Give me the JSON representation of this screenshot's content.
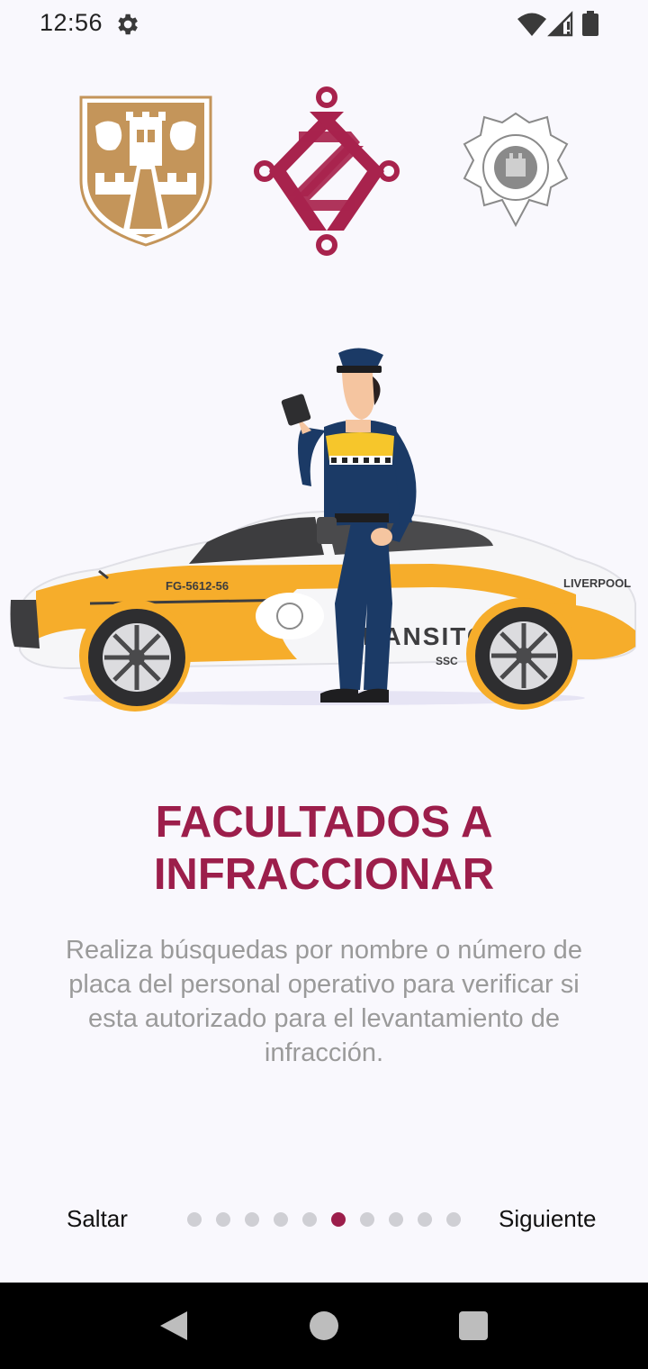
{
  "status_bar": {
    "time": "12:56",
    "icons": [
      "gear-icon",
      "wifi-icon",
      "cell-signal-icon",
      "battery-icon"
    ]
  },
  "logos": [
    "cdmx-shield-logo",
    "cdmx-knot-logo",
    "seguridad-ciudadana-badge-logo"
  ],
  "hero": {
    "car_plate": "FG-5612-56",
    "car_brand": "LIVERPOOL",
    "car_text": "TRANSITO",
    "car_subtext": "SSC"
  },
  "onboarding": {
    "title_line1": "FACULTADOS A",
    "title_line2": "INFRACCIONAR",
    "description": "Realiza búsquedas por nombre o número de placa del personal operativo para verificar si esta autorizado para el levantamiento de infracción.",
    "skip_label": "Saltar",
    "next_label": "Siguiente",
    "page_count": 10,
    "current_page": 6
  },
  "colors": {
    "accent": "#9c1e4b",
    "gold": "#c4955a",
    "taxi_yellow": "#f6ad2b",
    "uniform_navy": "#1b3a66",
    "text_gray": "#9a9a9a"
  },
  "nav_bar": {
    "icons": [
      "back-icon",
      "home-icon",
      "recents-icon"
    ]
  }
}
